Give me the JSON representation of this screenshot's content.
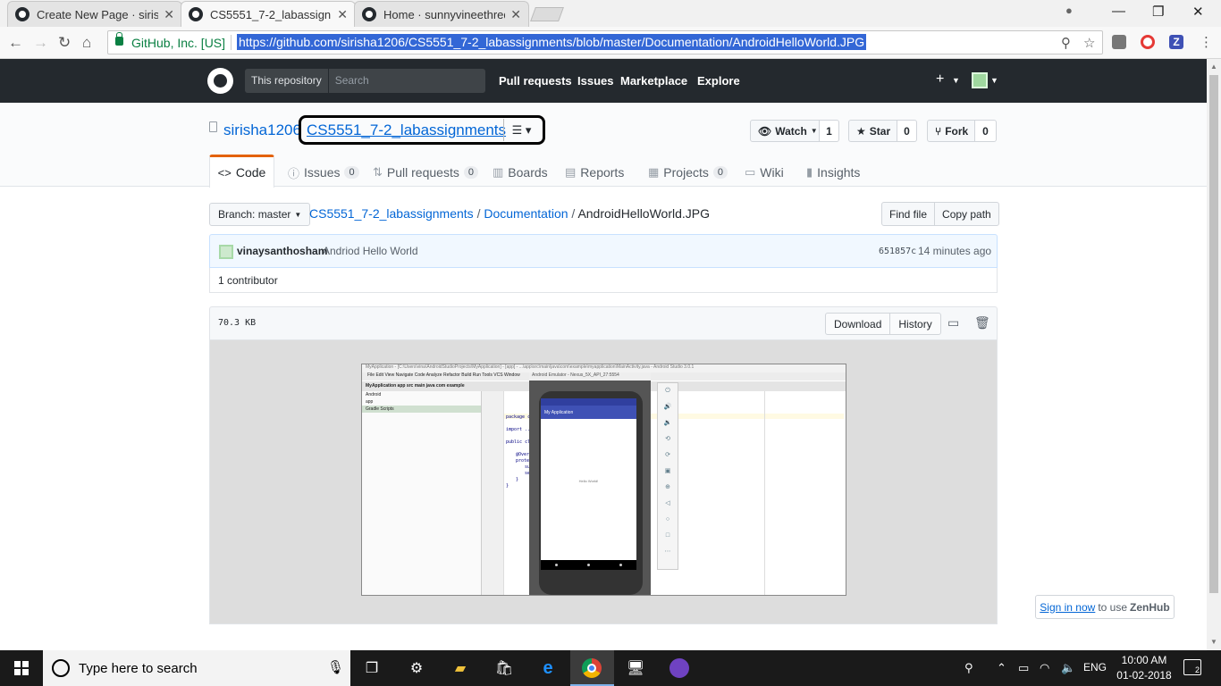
{
  "browser": {
    "tabs": [
      {
        "title": "Create New Page · sirisha",
        "active": false
      },
      {
        "title": "CS5551_7-2_labassignme",
        "active": true
      },
      {
        "title": "Home · sunnyvineethredd",
        "active": false
      }
    ],
    "security_label": "GitHub, Inc. [US]",
    "url": "https://github.com/sirisha1206/CS5551_7-2_labassignments/blob/master/Documentation/AndroidHelloWorld.JPG"
  },
  "header": {
    "scope_label": "This repository",
    "search_placeholder": "Search",
    "nav": [
      "Pull requests",
      "Issues",
      "Marketplace",
      "Explore"
    ]
  },
  "repo": {
    "owner": "sirisha1206",
    "name": "CS5551_7-2_labassignments",
    "watch_label": "Watch",
    "watch_count": "1",
    "star_label": "Star",
    "star_count": "0",
    "fork_label": "Fork",
    "fork_count": "0",
    "tabs": [
      {
        "label": "Code",
        "count": null
      },
      {
        "label": "Issues",
        "count": "0"
      },
      {
        "label": "Pull requests",
        "count": "0"
      },
      {
        "label": "Boards",
        "count": null
      },
      {
        "label": "Reports",
        "count": null
      },
      {
        "label": "Projects",
        "count": "0"
      },
      {
        "label": "Wiki",
        "count": null
      },
      {
        "label": "Insights",
        "count": null
      }
    ]
  },
  "file": {
    "branch_label": "Branch: master",
    "path_repo": "CS5551_7-2_labassignments",
    "path_dir": "Documentation",
    "path_file": "AndroidHelloWorld.JPG",
    "find_file": "Find file",
    "copy_path": "Copy path",
    "commit_author": "vinaysanthosham",
    "commit_message": "Andriod Hello World",
    "commit_sha": "651857c",
    "commit_time": "14 minutes ago",
    "contributors": "1 contributor",
    "size": "70.3 KB",
    "download": "Download",
    "history": "History"
  },
  "image": {
    "window_title": "MyApplication - [C:\\Users\\vina\\AndroidStudioProjects\\MyApplication] - [app] - ...\\app\\src\\main\\java\\com\\example\\myapplication\\MainActivity.java - Android Studio 3.0.1",
    "menu": "File  Edit  View  Navigate  Code  Analyze  Refactor  Build  Run  Tools  VCS  Window",
    "breadcrumb": "MyApplication  app  src  main  java  com  example",
    "project_rows": [
      "Android",
      "app",
      "Gradle Scripts"
    ],
    "code_lines": [
      "package c",
      "import ...",
      "public cla",
      "@Overr",
      "protec",
      "su",
      "se",
      "}",
      "}"
    ],
    "emulator_title": "Android Emulator - Nexus_5X_API_27:5554",
    "app_title": "My Application",
    "hello_text": "Hello World!"
  },
  "zenhub": {
    "link": "Sign in now",
    "mid": "to use",
    "brand": "ZenHub"
  },
  "taskbar": {
    "search_text": "Type here to search",
    "lang": "ENG",
    "time": "10:00 AM",
    "date": "01-02-2018",
    "notifications": "2"
  }
}
